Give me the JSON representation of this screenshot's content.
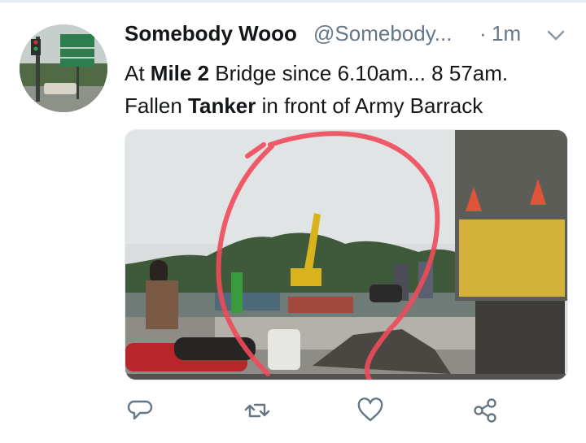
{
  "tweet": {
    "display_name": "Somebody Wooo",
    "handle": "@Somebody...",
    "separator": "·",
    "time": "1m",
    "text": {
      "line1_a": "At ",
      "line1_b": "Mile 2",
      "line1_c": " Bridge since 6.10am... 8 57am.",
      "line2_a": "Fallen ",
      "line2_b": "Tanker",
      "line2_c": " in front of Army Barrack"
    }
  },
  "icons": {
    "caret": "chevron-down-icon",
    "reply": "reply-icon",
    "retweet": "retweet-icon",
    "like": "heart-icon",
    "share": "share-icon"
  },
  "colors": {
    "text_primary": "#14171a",
    "text_secondary": "#657786",
    "icon": "#657786",
    "annotation_circle": "#f04a5a"
  }
}
